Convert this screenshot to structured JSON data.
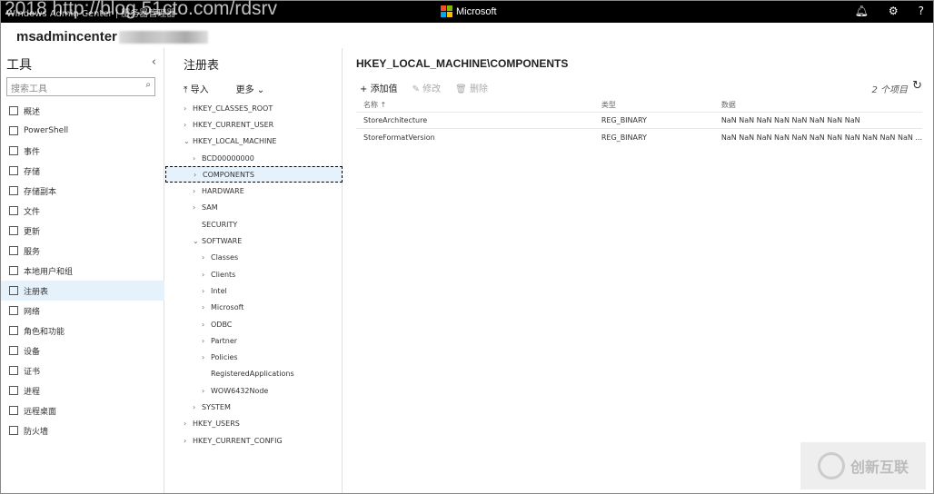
{
  "topbar": {
    "title": "Windows Admin Center | 服务器管理器",
    "watermark": "2018 http://blog.51cto.com/rdsrv",
    "brand": "Microsoft",
    "logo_colors": [
      "#f25022",
      "#7fba00",
      "#00a4ef",
      "#ffb900"
    ]
  },
  "server": "msadmincenter",
  "tools": {
    "title": "工具",
    "search_placeholder": "搜索工具",
    "items": [
      {
        "label": "概述",
        "icon": "overview-icon"
      },
      {
        "label": "PowerShell",
        "icon": "powershell-icon"
      },
      {
        "label": "事件",
        "icon": "events-icon"
      },
      {
        "label": "存储",
        "icon": "storage-icon"
      },
      {
        "label": "存储副本",
        "icon": "storage-replica-icon"
      },
      {
        "label": "文件",
        "icon": "files-icon"
      },
      {
        "label": "更新",
        "icon": "updates-icon"
      },
      {
        "label": "服务",
        "icon": "services-icon"
      },
      {
        "label": "本地用户和组",
        "icon": "users-icon"
      },
      {
        "label": "注册表",
        "icon": "registry-icon",
        "active": true
      },
      {
        "label": "网络",
        "icon": "network-icon"
      },
      {
        "label": "角色和功能",
        "icon": "roles-icon"
      },
      {
        "label": "设备",
        "icon": "devices-icon"
      },
      {
        "label": "证书",
        "icon": "certificates-icon"
      },
      {
        "label": "进程",
        "icon": "processes-icon"
      },
      {
        "label": "远程桌面",
        "icon": "remote-desktop-icon"
      },
      {
        "label": "防火墙",
        "icon": "firewall-icon"
      }
    ]
  },
  "registry": {
    "title": "注册表",
    "import": "导入",
    "more": "更多",
    "tree": [
      {
        "label": "HKEY_CLASSES_ROOT",
        "level": 0,
        "chev": ">"
      },
      {
        "label": "HKEY_CURRENT_USER",
        "level": 0,
        "chev": ">"
      },
      {
        "label": "HKEY_LOCAL_MACHINE",
        "level": 0,
        "chev": "v"
      },
      {
        "label": "BCD00000000",
        "level": 1,
        "chev": ">"
      },
      {
        "label": "COMPONENTS",
        "level": 1,
        "chev": ">",
        "selected": true
      },
      {
        "label": "HARDWARE",
        "level": 1,
        "chev": ">"
      },
      {
        "label": "SAM",
        "level": 1,
        "chev": ">"
      },
      {
        "label": "SECURITY",
        "level": 1,
        "chev": ""
      },
      {
        "label": "SOFTWARE",
        "level": 1,
        "chev": "v"
      },
      {
        "label": "Classes",
        "level": 2,
        "chev": ">"
      },
      {
        "label": "Clients",
        "level": 2,
        "chev": ">"
      },
      {
        "label": "Intel",
        "level": 2,
        "chev": ">"
      },
      {
        "label": "Microsoft",
        "level": 2,
        "chev": ">"
      },
      {
        "label": "ODBC",
        "level": 2,
        "chev": ">"
      },
      {
        "label": "Partner",
        "level": 2,
        "chev": ">"
      },
      {
        "label": "Policies",
        "level": 2,
        "chev": ">"
      },
      {
        "label": "RegisteredApplications",
        "level": 2,
        "chev": ""
      },
      {
        "label": "WOW6432Node",
        "level": 2,
        "chev": ">"
      },
      {
        "label": "SYSTEM",
        "level": 1,
        "chev": ">"
      },
      {
        "label": "HKEY_USERS",
        "level": 0,
        "chev": ">"
      },
      {
        "label": "HKEY_CURRENT_CONFIG",
        "level": 0,
        "chev": ">"
      }
    ]
  },
  "main": {
    "path": "HKEY_LOCAL_MACHINE\\COMPONENTS",
    "add": "添加值",
    "edit": "修改",
    "delete": "删除",
    "count": "2 个项目",
    "columns": [
      "名称 ↑",
      "类型",
      "数据"
    ],
    "rows": [
      [
        "StoreArchitecture",
        "REG_BINARY",
        "NaN NaN NaN NaN NaN NaN NaN NaN"
      ],
      [
        "StoreFormatVersion",
        "REG_BINARY",
        "NaN NaN NaN NaN NaN NaN NaN NaN NaN NaN NaN ..."
      ]
    ]
  },
  "watermark_logo": "创新互联"
}
